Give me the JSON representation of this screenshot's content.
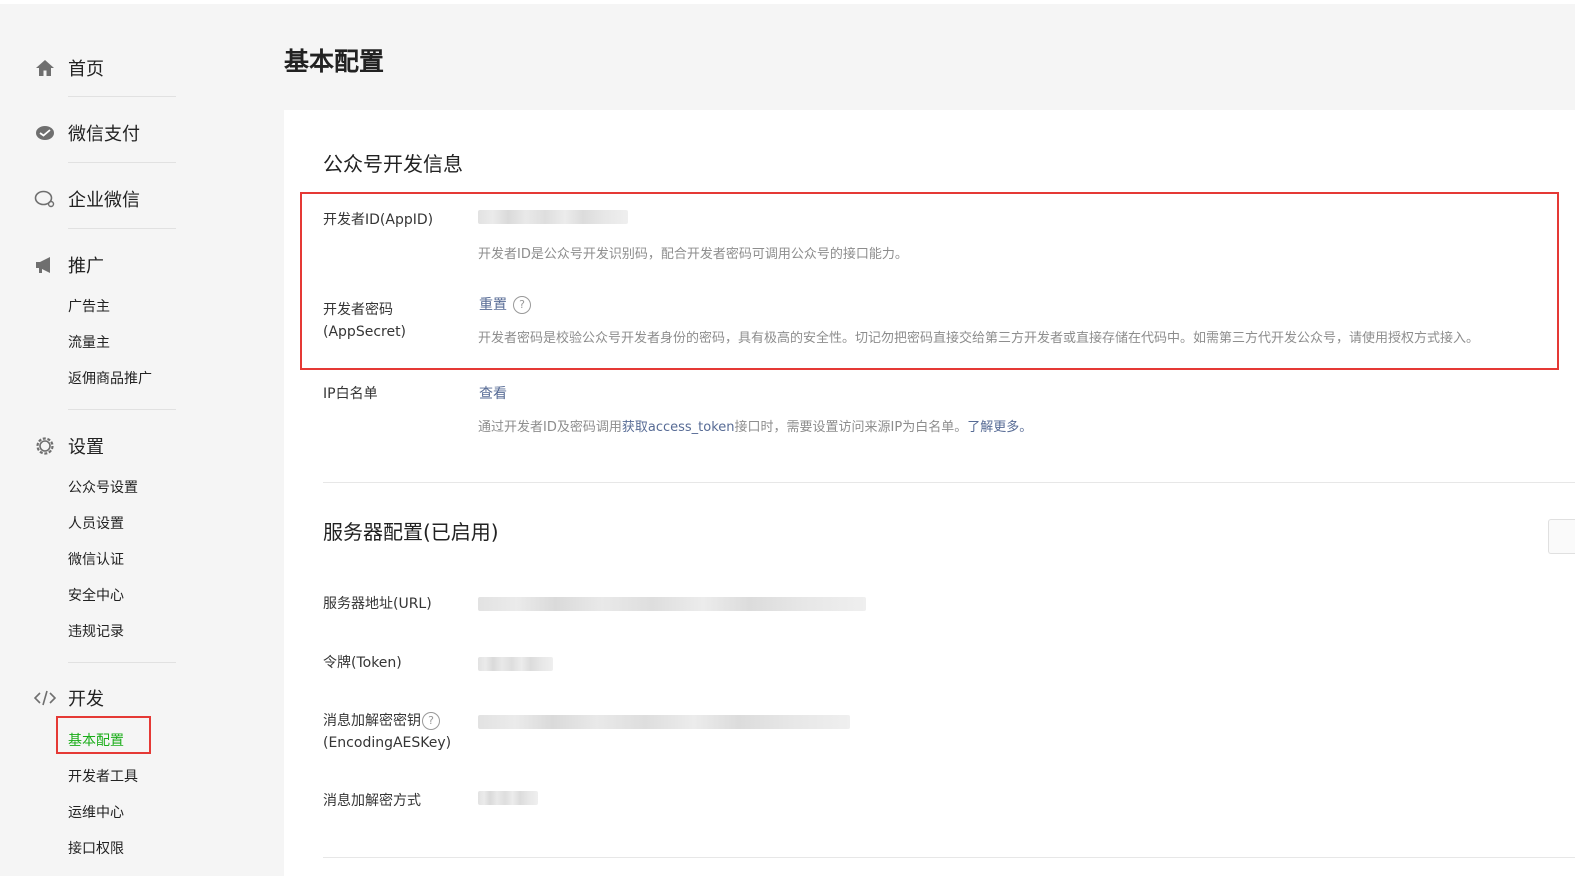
{
  "page": {
    "title": "基本配置"
  },
  "sidebar": {
    "groups": [
      {
        "icon": "home-icon",
        "label": "首页",
        "items": []
      },
      {
        "icon": "wechat-pay-icon",
        "label": "微信支付",
        "items": []
      },
      {
        "icon": "enterprise-wechat-icon",
        "label": "企业微信",
        "items": []
      },
      {
        "icon": "megaphone-icon",
        "label": "推广",
        "items": [
          "广告主",
          "流量主",
          "返佣商品推广"
        ]
      },
      {
        "icon": "gear-icon",
        "label": "设置",
        "items": [
          "公众号设置",
          "人员设置",
          "微信认证",
          "安全中心",
          "违规记录"
        ]
      },
      {
        "icon": "code-icon",
        "label": "开发",
        "items": [
          "基本配置",
          "开发者工具",
          "运维中心",
          "接口权限"
        ]
      }
    ],
    "active_item": "基本配置"
  },
  "dev_info": {
    "title": "公众号开发信息",
    "appid": {
      "label": "开发者ID(AppID)",
      "desc": "开发者ID是公众号开发识别码，配合开发者密码可调用公众号的接口能力。"
    },
    "appsecret": {
      "label_line1": "开发者密码",
      "label_line2": "(AppSecret)",
      "action": "重置",
      "help": "?",
      "desc": "开发者密码是校验公众号开发者身份的密码，具有极高的安全性。切记勿把密码直接交给第三方开发者或直接存储在代码中。如需第三方代开发公众号，请使用授权方式接入。"
    },
    "ip_whitelist": {
      "label": "IP白名单",
      "action": "查看",
      "desc_prefix": "通过开发者ID及密码调用",
      "desc_link": "获取access_token",
      "desc_middle": "接口时，需要设置访问来源IP为白名单。",
      "desc_more": "了解更多。"
    }
  },
  "server_config": {
    "title": "服务器配置(已启用)",
    "url_label": "服务器地址(URL)",
    "token_label": "令牌(Token)",
    "aeskey_label_line1": "消息加解密密钥",
    "aeskey_help": "?",
    "aeskey_label_line2": "(EncodingAESKey)",
    "encrypt_mode_label": "消息加解密方式"
  }
}
